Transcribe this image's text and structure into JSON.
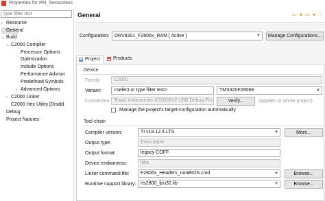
{
  "window": {
    "title": "Properties for PM_Sensorless"
  },
  "filter": {
    "placeholder": "type filter text"
  },
  "tree": {
    "items": [
      {
        "label": "Resource",
        "twisty": "›"
      },
      {
        "label": "General",
        "twisty": ""
      },
      {
        "label": "Build",
        "twisty": "⌄"
      },
      {
        "label": "C2000 Compiler",
        "twisty": "⌄"
      },
      {
        "label": "Processor Options",
        "twisty": ""
      },
      {
        "label": "Optimization",
        "twisty": ""
      },
      {
        "label": "Include Options",
        "twisty": ""
      },
      {
        "label": "Performance Advisor",
        "twisty": ""
      },
      {
        "label": "Predefined Symbols",
        "twisty": ""
      },
      {
        "label": "Advanced Options",
        "twisty": "›"
      },
      {
        "label": "C2000 Linker",
        "twisty": "›"
      },
      {
        "label": "C2000 Hex Utility  [Disabl",
        "twisty": ""
      },
      {
        "label": "Debug",
        "twisty": ""
      },
      {
        "label": "Project Natures",
        "twisty": ""
      }
    ]
  },
  "header": {
    "title": "General",
    "nav_icons": "⇦ ▾ ⇨ ▾ ⋮"
  },
  "configuration": {
    "label": "Configuration:",
    "value": "DRV8301_F2806x_RAM  [ Active ]",
    "manage_button": "Manage Configurations..."
  },
  "tabs": [
    {
      "label": "Project"
    },
    {
      "label": "Products"
    }
  ],
  "device": {
    "group_title": "Device",
    "family_label": "Family:",
    "family_value": "C2000",
    "variant_label": "Variant:",
    "variant_filter": "<select or type filter text>",
    "variant_value": "TMS320F28069",
    "connection_label": "Connection:",
    "connection_value": "Texas Instruments XDS100v2 USB Debug Pro",
    "verify_button": "Verify...",
    "connection_note": "(applies to whole project)",
    "manage_target_label": "Manage the project's target-configuration automatically"
  },
  "toolchain": {
    "group_title": "Tool-chain",
    "compiler_label": "Compiler version:",
    "compiler_value": "TI v18.12.4.LTS",
    "more_button": "More...",
    "output_type_label": "Output type:",
    "output_type_value": "Executable",
    "output_format_label": "Output format:",
    "output_format_value": "legacy COFF",
    "endianness_label": "Device endianness:",
    "endianness_value": "little",
    "linker_label": "Linker command file:",
    "linker_value": "F2806x_Headers_nonBIOS.cmd",
    "browse_button": "Browse...",
    "runtime_label": "Runtime support library:",
    "runtime_value": "rts2800_fpu32.lib",
    "browse_button_2": "Browse..."
  }
}
